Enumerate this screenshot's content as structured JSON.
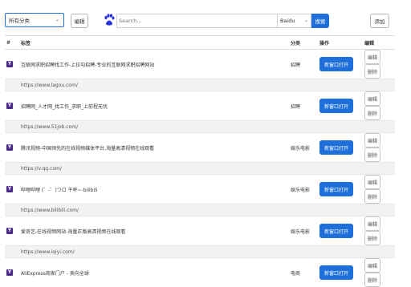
{
  "toolbar": {
    "category_select": "所有分类",
    "edit_label": "编辑",
    "search_placeholder": "Search...",
    "engine": "Baidu",
    "search_label": "搜索",
    "add_label": "添加"
  },
  "table": {
    "headers": [
      "#",
      "标签",
      "分类",
      "操作",
      "编辑"
    ],
    "open_label": "新窗口打开",
    "edit_label": "编辑",
    "delete_label": "删除",
    "rows": [
      {
        "title": "互联网求职招聘找工作-上拉勾招聘-专业的互联网求职招聘网站",
        "url": "https://www.lagou.com/",
        "category": "招聘"
      },
      {
        "title": "招聘网_人才网_找工作_求职_上前程无忧",
        "url": "https://www.51job.com/",
        "category": "招聘"
      },
      {
        "title": "腾讯视频-中国领先的在线视频媒体平台,海量高清视频在线观看",
        "url": "https://v.qq.com/",
        "category": "娱乐电影"
      },
      {
        "title": "哔哩哔哩 (゜-゜)つロ 干杯~-bilibili",
        "url": "https://www.bilibili.com/",
        "category": "娱乐电影"
      },
      {
        "title": "爱奇艺-在线视频网站-海量正版高清视频在线观看",
        "url": "https://www.iqiyi.com/",
        "category": "娱乐电影"
      },
      {
        "title": "AliExpress商家门户 - 卖向全球",
        "url": "",
        "category": "电商"
      }
    ]
  }
}
